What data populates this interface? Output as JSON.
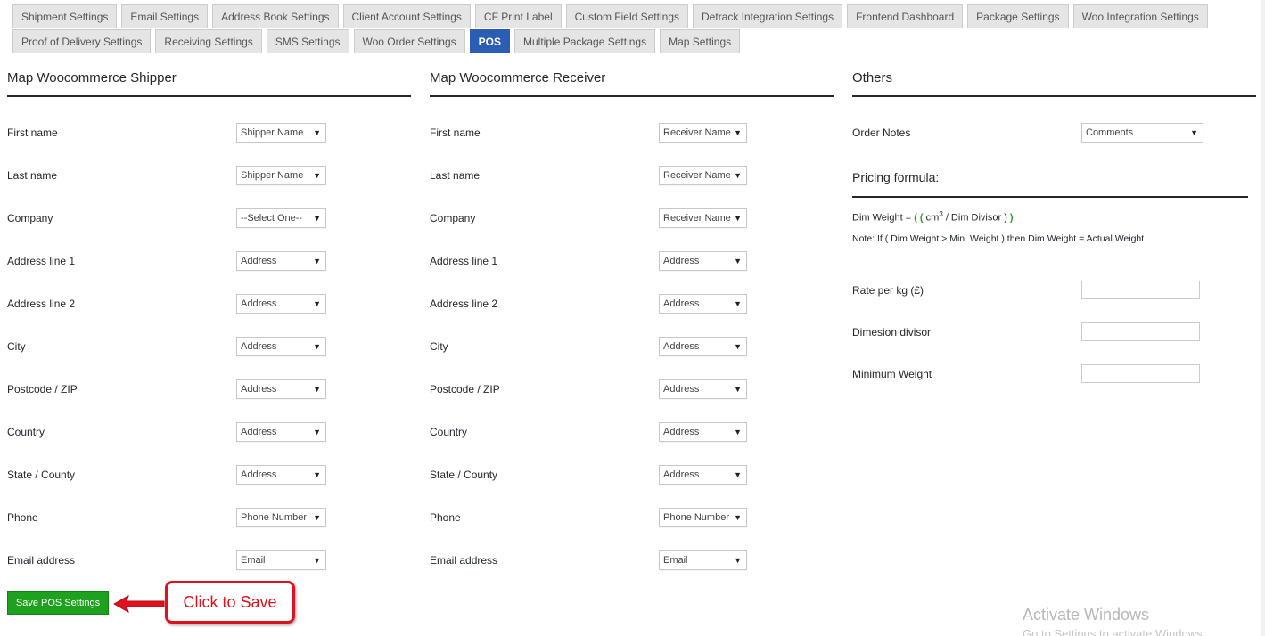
{
  "tabs_row1": [
    "Shipment Settings",
    "Email Settings",
    "Address Book Settings",
    "Client Account Settings",
    "CF Print Label",
    "Custom Field Settings",
    "Detrack Integration Settings",
    "Frontend Dashboard",
    "Package Settings",
    "Woo Integration Settings"
  ],
  "tabs_row2": [
    "Proof of Delivery Settings",
    "Receiving Settings",
    "SMS Settings",
    "Woo Order Settings",
    "POS",
    "Multiple Package Settings",
    "Map Settings"
  ],
  "active_tab": "POS",
  "shipper": {
    "title": "Map Woocommerce Shipper",
    "rows": [
      {
        "label": "First name",
        "value": "Shipper Name"
      },
      {
        "label": "Last name",
        "value": "Shipper Name"
      },
      {
        "label": "Company",
        "value": "--Select One--"
      },
      {
        "label": "Address line 1",
        "value": "Address"
      },
      {
        "label": "Address line 2",
        "value": "Address"
      },
      {
        "label": "City",
        "value": "Address"
      },
      {
        "label": "Postcode / ZIP",
        "value": "Address"
      },
      {
        "label": "Country",
        "value": "Address"
      },
      {
        "label": "State / County",
        "value": "Address"
      },
      {
        "label": "Phone",
        "value": "Phone Number"
      },
      {
        "label": "Email address",
        "value": "Email"
      }
    ]
  },
  "receiver": {
    "title": "Map Woocommerce Receiver",
    "rows": [
      {
        "label": "First name",
        "value": "Receiver Name"
      },
      {
        "label": "Last name",
        "value": "Receiver Name"
      },
      {
        "label": "Company",
        "value": "Receiver Name"
      },
      {
        "label": "Address line 1",
        "value": "Address"
      },
      {
        "label": "Address line 2",
        "value": "Address"
      },
      {
        "label": "City",
        "value": "Address"
      },
      {
        "label": "Postcode / ZIP",
        "value": "Address"
      },
      {
        "label": "Country",
        "value": "Address"
      },
      {
        "label": "State / County",
        "value": "Address"
      },
      {
        "label": "Phone",
        "value": "Phone Number"
      },
      {
        "label": "Email address",
        "value": "Email"
      }
    ]
  },
  "others": {
    "title": "Others",
    "order_notes_label": "Order Notes",
    "order_notes_value": "Comments",
    "pricing_title": "Pricing formula:",
    "formula_prefix": "Dim Weight = ",
    "formula_open": "( (",
    "formula_cm": " cm",
    "formula_exp": "3",
    "formula_mid": " / Dim Divisor )",
    "formula_close": " )",
    "note": "Note: If ( Dim Weight > Min. Weight ) then Dim Weight = Actual Weight",
    "rate_label": "Rate per kg (£)",
    "divisor_label": "Dimesion divisor",
    "min_weight_label": "Minimum Weight"
  },
  "save_label": "Save POS Settings",
  "callout_text": "Click to Save",
  "watermark_title": "Activate Windows",
  "watermark_sub": "Go to Settings to activate Windows.",
  "colors": {
    "active_tab": "#2b5db5",
    "save_button": "#1ea11e",
    "callout": "#e0101c"
  }
}
